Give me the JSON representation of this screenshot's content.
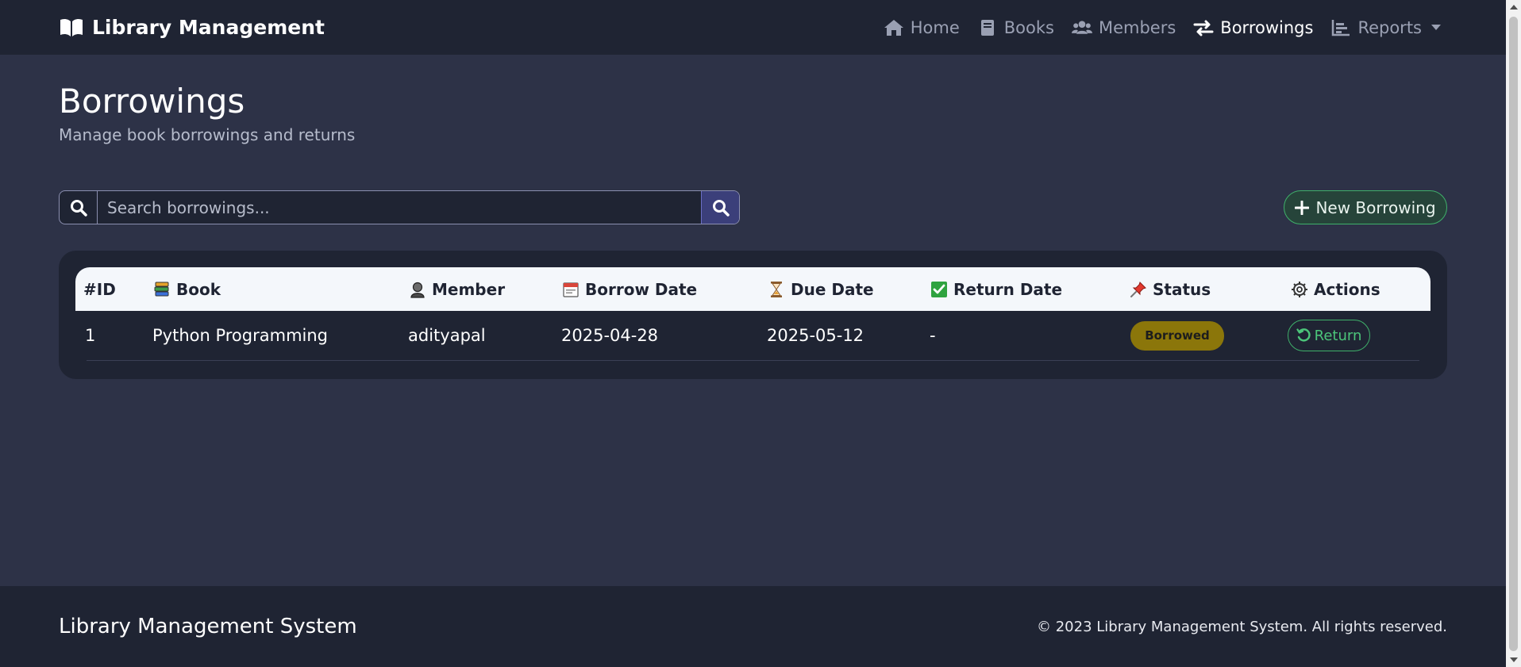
{
  "brand": {
    "title": "Library Management",
    "icon": "book-open-icon"
  },
  "nav": {
    "items": [
      {
        "label": "Home",
        "icon": "home-icon",
        "active": false
      },
      {
        "label": "Books",
        "icon": "book-icon",
        "active": false
      },
      {
        "label": "Members",
        "icon": "users-icon",
        "active": false
      },
      {
        "label": "Borrowings",
        "icon": "exchange-icon",
        "active": true
      },
      {
        "label": "Reports",
        "icon": "chart-icon",
        "active": false,
        "dropdown": true
      }
    ]
  },
  "header": {
    "title": "Borrowings",
    "subtitle": "Manage book borrowings and returns"
  },
  "search": {
    "placeholder": "Search borrowings...",
    "value": ""
  },
  "new_button": {
    "label": "New Borrowing"
  },
  "table": {
    "columns": [
      {
        "label": "#ID",
        "icon": ""
      },
      {
        "label": "Book",
        "icon": "books-icon"
      },
      {
        "label": "Member",
        "icon": "person-icon"
      },
      {
        "label": "Borrow Date",
        "icon": "calendar-icon"
      },
      {
        "label": "Due Date",
        "icon": "hourglass-icon"
      },
      {
        "label": "Return Date",
        "icon": "check-box-icon"
      },
      {
        "label": "Status",
        "icon": "pushpin-icon"
      },
      {
        "label": "Actions",
        "icon": "gear-icon"
      }
    ],
    "rows": [
      {
        "id": "1",
        "book": "Python Programming",
        "member": "adityapal",
        "borrow_date": "2025-04-28",
        "due_date": "2025-05-12",
        "return_date": "-",
        "status": "Borrowed",
        "action": "Return"
      }
    ]
  },
  "footer": {
    "title": "Library Management System",
    "copyright": "© 2023 Library Management System. All rights reserved."
  },
  "colors": {
    "background": "#2d3247",
    "navbar": "#1f2433",
    "accent_green": "#3fb06a",
    "status_borrowed": "#8b760a"
  }
}
